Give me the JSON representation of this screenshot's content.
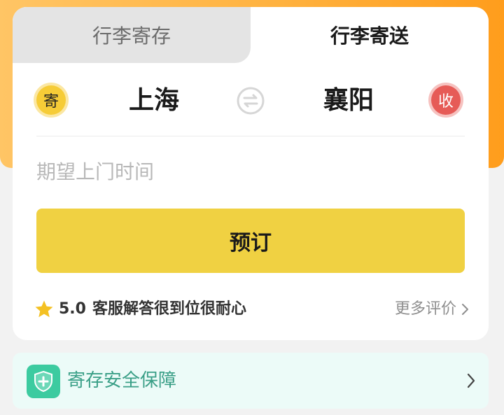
{
  "tabs": {
    "storage_label": "行李寄存",
    "delivery_label": "行李寄送",
    "active": "delivery"
  },
  "route": {
    "send_badge": "寄",
    "from_city": "上海",
    "to_city": "襄阳",
    "receive_badge": "收",
    "swap_icon": "swap-arrows-icon"
  },
  "pickup_time": {
    "placeholder": "期望上门时间"
  },
  "book_button": {
    "label": "预订"
  },
  "review": {
    "rating": "5.0",
    "text": "客服解答很到位很耐心",
    "more_label": "更多评价"
  },
  "security": {
    "label": "寄存安全保障",
    "icon": "shield-plus-icon"
  },
  "colors": {
    "accent_yellow": "#f0d142",
    "banner_orange": "#ffb23f",
    "send_badge": "#f6cc37",
    "receive_badge": "#e65b57",
    "security_bg": "#ecfbf8",
    "security_text": "#3a9f87"
  }
}
